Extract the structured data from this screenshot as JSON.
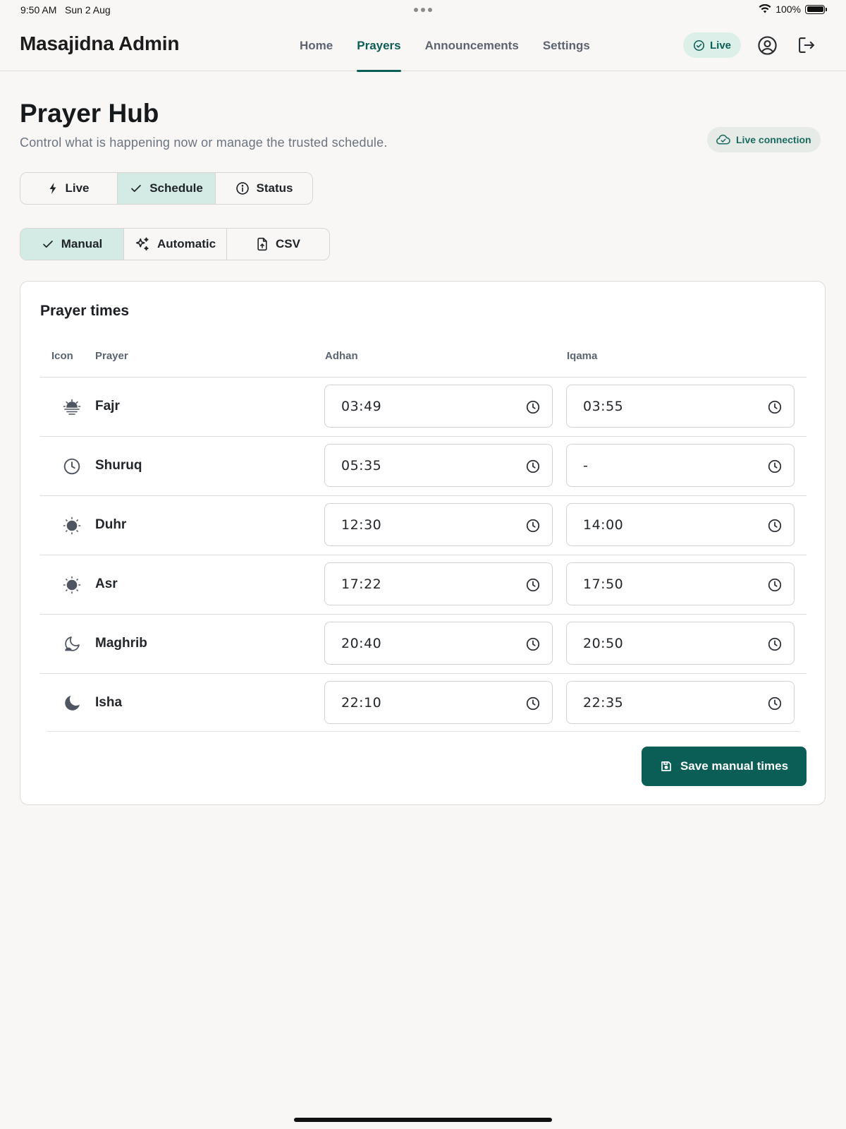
{
  "statusbar": {
    "time": "9:50 AM",
    "date": "Sun 2 Aug",
    "battery": "100%"
  },
  "nav": {
    "brand": "Masajidna Admin",
    "links": [
      "Home",
      "Prayers",
      "Announcements",
      "Settings"
    ],
    "active": "Prayers",
    "live_label": "Live"
  },
  "header": {
    "title": "Prayer Hub",
    "subtitle": "Control what is happening now or manage the trusted schedule.",
    "connection": "Live connection"
  },
  "mode_tabs": [
    {
      "label": "Live",
      "icon": "bolt-icon"
    },
    {
      "label": "Schedule",
      "icon": "check-icon",
      "active": true
    },
    {
      "label": "Status",
      "icon": "info-icon"
    }
  ],
  "source_tabs": [
    {
      "label": "Manual",
      "icon": "check-icon",
      "active": true
    },
    {
      "label": "Automatic",
      "icon": "sparkles-icon"
    },
    {
      "label": "CSV",
      "icon": "file-upload-icon"
    }
  ],
  "prayer_card": {
    "title": "Prayer times",
    "columns": {
      "icon": "Icon",
      "prayer": "Prayer",
      "adhan": "Adhan",
      "iqama": "Iqama"
    },
    "rows": [
      {
        "name": "Fajr",
        "icon": "sunrise-icon",
        "adhan": "03:49",
        "iqama": "03:55"
      },
      {
        "name": "Shuruq",
        "icon": "clock-icon",
        "adhan": "05:35",
        "iqama": "-"
      },
      {
        "name": "Duhr",
        "icon": "sun-icon",
        "adhan": "12:30",
        "iqama": "14:00"
      },
      {
        "name": "Asr",
        "icon": "sun-icon",
        "adhan": "17:22",
        "iqama": "17:50"
      },
      {
        "name": "Maghrib",
        "icon": "moon-outline-icon",
        "adhan": "20:40",
        "iqama": "20:50"
      },
      {
        "name": "Isha",
        "icon": "moon-icon",
        "adhan": "22:10",
        "iqama": "22:35"
      }
    ],
    "save_label": "Save manual times"
  },
  "colors": {
    "accent": "#0b5e55",
    "accent_soft": "#d3ebe4",
    "background": "#f8f7f5"
  }
}
